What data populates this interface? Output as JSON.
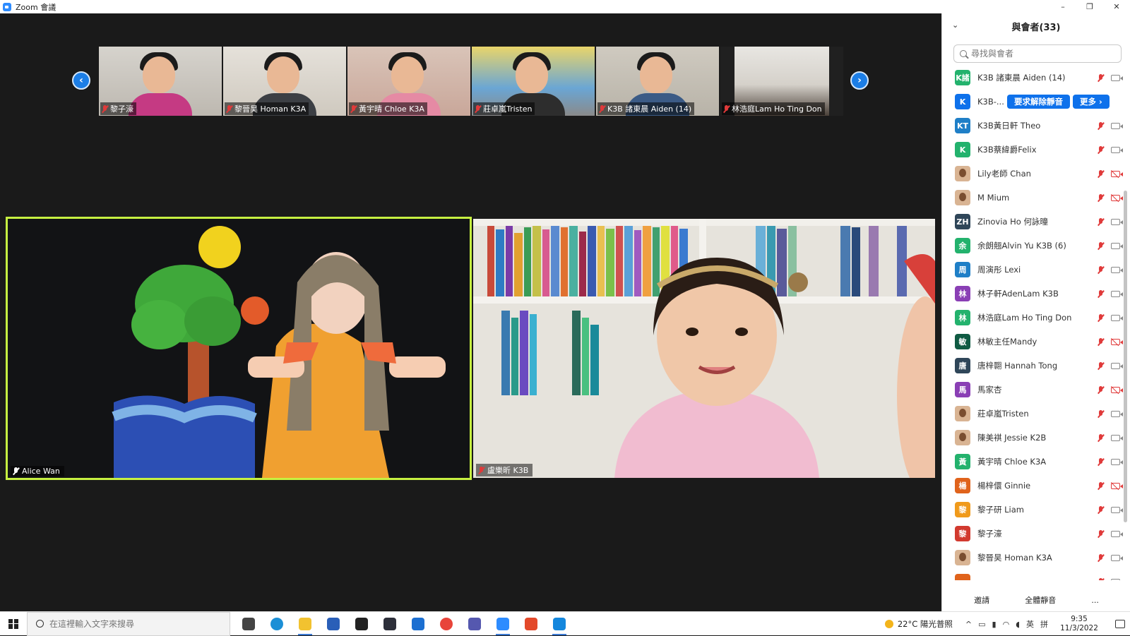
{
  "window": {
    "title": "Zoom 會議",
    "minimize": "–",
    "maximize": "❐",
    "close": "✕"
  },
  "strip": {
    "prev": "‹",
    "next": "›",
    "thumbnails": [
      {
        "name": "黎子濠"
      },
      {
        "name": "黎晉昊 Homan K3A"
      },
      {
        "name": "黃宇晴 Chloe K3A"
      },
      {
        "name": "莊卓嵐Tristen"
      },
      {
        "name": "K3B 諸東晨 Aiden (14)"
      },
      {
        "name": "林浩庭Lam Ho Ting Don"
      }
    ]
  },
  "videos": {
    "speaker": {
      "name": "Alice Wan"
    },
    "second": {
      "name": "盧樂昕 K3B"
    }
  },
  "participants": {
    "title": "與會者(33)",
    "collapse_icon": "⌄",
    "search_placeholder": "尋找與會者",
    "hover_actions": {
      "unmute": "要求解除靜音",
      "more": "更多 ›"
    },
    "list": [
      {
        "initials": "K諸",
        "color": "#23b26d",
        "name": "K3B 諸東晨 Aiden (14)",
        "cam_off": false
      },
      {
        "initials": "K",
        "color": "#0e71eb",
        "name": "K3B-...",
        "cam_off": false,
        "hover": true
      },
      {
        "initials": "KT",
        "color": "#1f7fc7",
        "name": "K3B黃日軒 Theo",
        "cam_off": false
      },
      {
        "initials": "K",
        "color": "#23b26d",
        "name": "K3B蔡緯爵Felix",
        "cam_off": false
      },
      {
        "initials": "",
        "color": "photo",
        "name": "Lily老師 Chan",
        "cam_off": true
      },
      {
        "initials": "",
        "color": "photo",
        "name": "M Mium",
        "cam_off": true
      },
      {
        "initials": "ZH",
        "color": "#2f4659",
        "name": "Zinovia Ho 何詠曈",
        "cam_off": false
      },
      {
        "initials": "余",
        "color": "#23b26d",
        "name": "余朗翹Alvin Yu K3B (6)",
        "cam_off": false
      },
      {
        "initials": "周",
        "color": "#1f7fc7",
        "name": "周演彤 Lexi",
        "cam_off": false
      },
      {
        "initials": "林",
        "color": "#8a3fb5",
        "name": "林子軒AdenLam K3B",
        "cam_off": false
      },
      {
        "initials": "林",
        "color": "#23b26d",
        "name": "林浩庭Lam Ho Ting Don",
        "cam_off": false
      },
      {
        "initials": "敏",
        "color": "#0f5b43",
        "name": "林敏主任Mandy",
        "cam_off": true
      },
      {
        "initials": "唐",
        "color": "#2f4659",
        "name": "唐梓翾 Hannah Tong",
        "cam_off": false
      },
      {
        "initials": "馬",
        "color": "#8a3fb5",
        "name": "馬家杏",
        "cam_off": true
      },
      {
        "initials": "",
        "color": "photo",
        "name": "莊卓嵐Tristen",
        "cam_off": false
      },
      {
        "initials": "",
        "color": "photo",
        "name": "陳美褀 Jessie K2B",
        "cam_off": false
      },
      {
        "initials": "黃",
        "color": "#23b26d",
        "name": "黃宇晴 Chloe K3A",
        "cam_off": false
      },
      {
        "initials": "楊",
        "color": "#e0631c",
        "name": "楊梓儇 Ginnie",
        "cam_off": true
      },
      {
        "initials": "黎",
        "color": "#f09a1b",
        "name": "黎子研 Liam",
        "cam_off": false
      },
      {
        "initials": "黎",
        "color": "#d23a2f",
        "name": "黎子濠",
        "cam_off": false
      },
      {
        "initials": "",
        "color": "photo",
        "name": "黎晉昊 Homan K3A",
        "cam_off": false
      },
      {
        "initials": "",
        "color": "#e0631c",
        "name": "",
        "cam_off": false
      }
    ],
    "footer": {
      "invite": "邀請",
      "mute_all": "全體靜音",
      "more": "..."
    }
  },
  "taskbar": {
    "search_placeholder": "在這裡輸入文字來搜尋",
    "apps": [
      {
        "name": "task-view-icon",
        "color": "#444444"
      },
      {
        "name": "edge-icon",
        "color": "#1b8fd6"
      },
      {
        "name": "file-explorer-icon",
        "color": "#f2c230"
      },
      {
        "name": "store-icon",
        "color": "#2a5fb8"
      },
      {
        "name": "dropbox-icon",
        "color": "#222222"
      },
      {
        "name": "terminal-icon",
        "color": "#2d2f3a"
      },
      {
        "name": "mail-icon",
        "color": "#1c6fd1"
      },
      {
        "name": "chrome-icon",
        "color": "#e8443a"
      },
      {
        "name": "teams-icon",
        "color": "#5558af"
      },
      {
        "name": "zoom-icon",
        "color": "#2d8cff"
      },
      {
        "name": "office-icon",
        "color": "#e3492a"
      },
      {
        "name": "whiteboard-icon",
        "color": "#1487dd"
      }
    ],
    "weather": "22°C  陽光普照",
    "ime_lang": "英",
    "ime_mode": "拼",
    "time": "9:35",
    "date": "11/3/2022"
  }
}
